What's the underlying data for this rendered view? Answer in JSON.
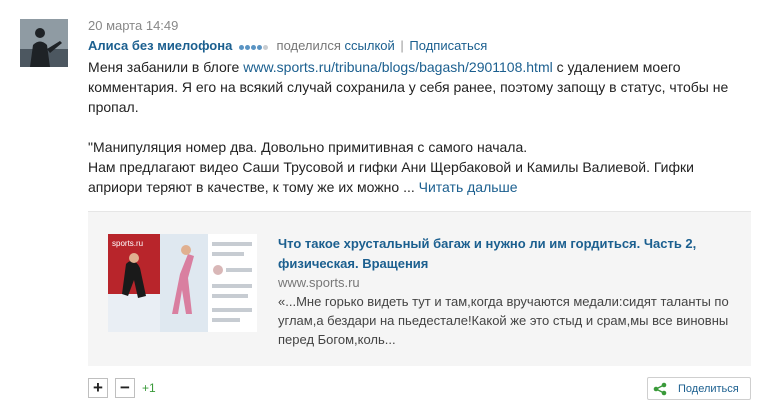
{
  "post": {
    "time": "20 марта 14:49",
    "author": "Алиса без миелофона",
    "rating_dots_on": 4,
    "rating_dots_total": 5,
    "shared_text": "поделился",
    "shared_link_text": "ссылкой",
    "separator": "|",
    "subscribe_label": "Подписаться",
    "text_before_link": "Меня забанили в блоге ",
    "blog_url": "www.sports.ru/tribuna/blogs/bagash/2901108.html",
    "text_after_link": " с удалением моего комментария. Я его на всякий случай сохранила у себя ранее, поэтому запощу в статус, чтобы не пропал.",
    "quote_line1": "\"Манипуляция номер два. Довольно примитивная с самого начала.",
    "quote_line2": "Нам предлагают видео Саши Трусовой и гифки Ани Щербаковой и Камилы Валиевой. Гифки априори теряют в качестве, к тому же их можно ... ",
    "read_more": "Читать дальше"
  },
  "link_card": {
    "title": "Что такое хрустальный багаж и нужно ли им гордиться. Часть 2, физическая. Вращения",
    "domain": "www.sports.ru",
    "excerpt": "«...Мне горько видеть тут и там,когда вручаются медали:сидят таланты по углам,а бездари на пьедестале!Какой же это стыд и срам,мы все виновны перед Богом,коль...",
    "thumb_brand": "sports.ru"
  },
  "footer": {
    "plus_label": "+",
    "minus_label": "−",
    "score": "+1",
    "share_label": "Поделиться"
  },
  "colors": {
    "link": "#1b5f8f",
    "score_green": "#3a9a3a",
    "share_icon_green": "#3a9a3a",
    "card_bg": "#f5f5f5"
  },
  "icons": {
    "avatar": "silhouette-avatar",
    "share": "share-icon"
  }
}
